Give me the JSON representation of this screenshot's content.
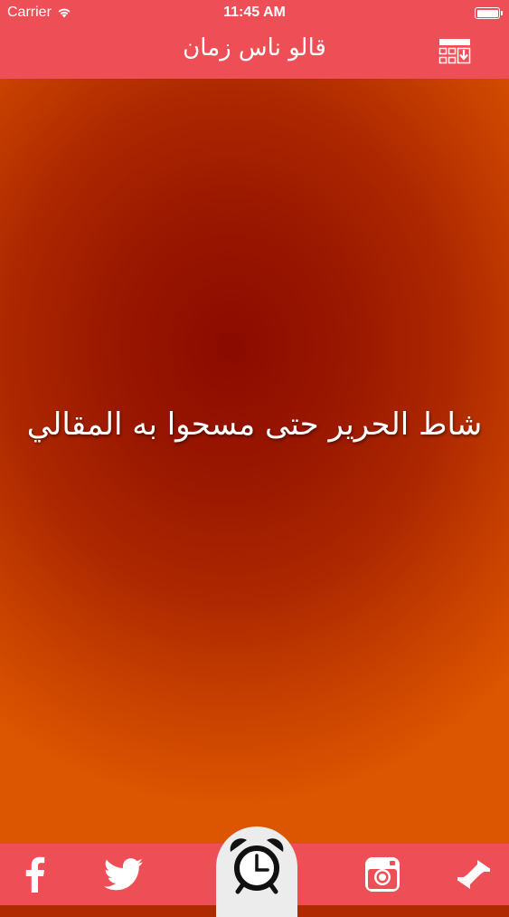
{
  "status_bar": {
    "carrier": "Carrier",
    "time": "11:45 AM",
    "battery_level": 1.0
  },
  "nav": {
    "title": "قالو ناس زمان",
    "right_icon": "download-list-icon"
  },
  "content": {
    "saying": "شاط الحرير حتى مسحوا به المقالي"
  },
  "tab_bar": {
    "items": [
      {
        "icon": "facebook-icon"
      },
      {
        "icon": "twitter-icon"
      },
      {
        "icon": "alarm-clock-icon"
      },
      {
        "icon": "instagram-icon"
      },
      {
        "icon": "shuffle-arrows-icon"
      }
    ]
  },
  "colors": {
    "bar": "#ee4f57",
    "bg_center": "#8b0a00",
    "bg_edge": "#dc5500"
  }
}
